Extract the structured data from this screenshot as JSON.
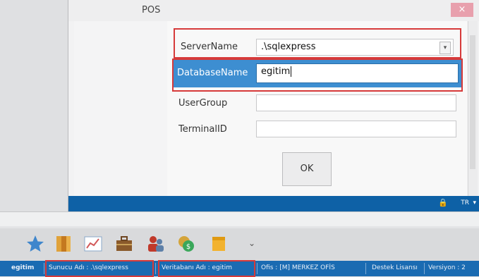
{
  "dialog": {
    "title": "POS",
    "close_glyph": "×",
    "fields": {
      "server_name": {
        "label": "ServerName",
        "value": ".\\sqlexpress"
      },
      "database_name": {
        "label": "DatabaseName",
        "value": "egitim"
      },
      "user_group": {
        "label": "UserGroup",
        "value": ""
      },
      "terminal_id": {
        "label": "TerminalID",
        "value": ""
      }
    },
    "ok_label": "OK",
    "footer": {
      "lock_glyph": "🔒",
      "language": "TR",
      "language_arrow": "▾"
    }
  },
  "launcher": {
    "chevron": "⌄",
    "icons": [
      "star-icon",
      "books-icon",
      "chart-icon",
      "briefcase-icon",
      "users-icon",
      "coins-icon",
      "box-icon"
    ]
  },
  "statusbar": {
    "db": "egitim",
    "server": "Sunucu Adı : .\\sqlexpress",
    "database": "Veritabanı Adı : egitim",
    "office": "Ofis : [M]  MERKEZ OFİS",
    "license": "Destek Lisansı",
    "version": "Versiyon : 2"
  },
  "colors": {
    "accent": "#0e61a6",
    "highlight": "#3d8ed1",
    "annotation": "#d63a3a"
  }
}
